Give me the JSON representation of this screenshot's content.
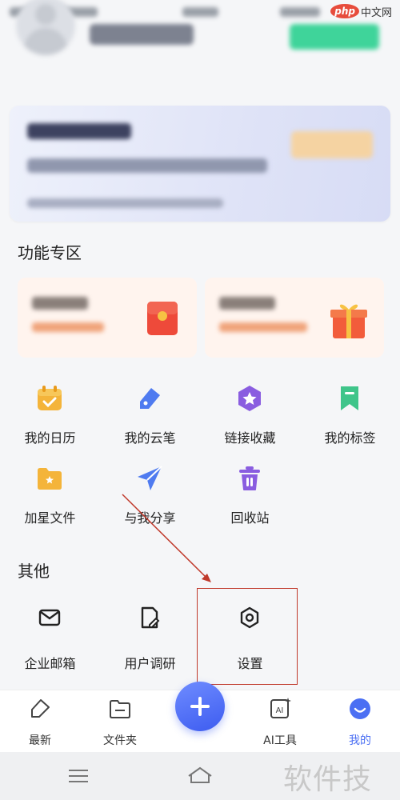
{
  "branding": {
    "php_badge": "php",
    "php_cn": "中文网"
  },
  "sections": {
    "features_title": "功能专区",
    "other_title": "其他"
  },
  "features": [
    {
      "label": "我的日历",
      "icon": "calendar-icon"
    },
    {
      "label": "我的云笔",
      "icon": "pen-tag-icon"
    },
    {
      "label": "链接收藏",
      "icon": "star-hexagon-icon"
    },
    {
      "label": "我的标签",
      "icon": "bookmark-icon"
    },
    {
      "label": "加星文件",
      "icon": "star-folder-icon"
    },
    {
      "label": "与我分享",
      "icon": "send-icon"
    },
    {
      "label": "回收站",
      "icon": "trash-icon"
    }
  ],
  "others": [
    {
      "label": "企业邮箱",
      "icon": "mail-icon"
    },
    {
      "label": "用户调研",
      "icon": "survey-icon"
    },
    {
      "label": "设置",
      "icon": "settings-icon"
    }
  ],
  "bottom_nav": [
    {
      "label": "最新",
      "icon": "tag-icon"
    },
    {
      "label": "文件夹",
      "icon": "folder-icon"
    },
    {
      "label": "AI工具",
      "icon": "ai-icon"
    },
    {
      "label": "我的",
      "icon": "profile-icon",
      "active": true
    }
  ],
  "fab": {
    "icon": "plus-icon"
  },
  "watermark": "软件技巧",
  "colors": {
    "accent": "#4b6ff3",
    "highlight": "#c0392b",
    "membership_btn": "#3fd49a"
  }
}
